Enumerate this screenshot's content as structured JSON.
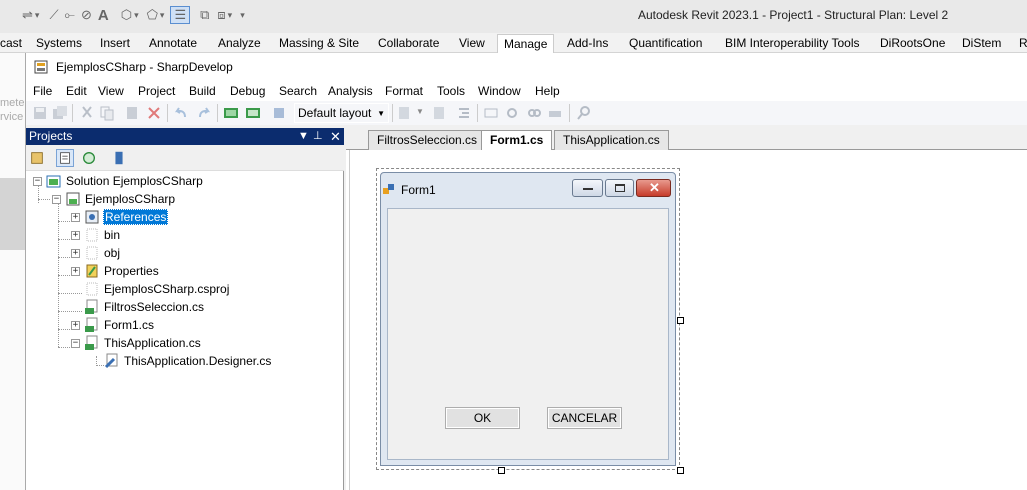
{
  "revit": {
    "title": "Autodesk Revit 2023.1 - Project1 - Structural Plan: Level 2",
    "tabs": [
      "cast",
      "Systems",
      "Insert",
      "Annotate",
      "Analyze",
      "Massing & Site",
      "Collaborate",
      "View",
      "Manage",
      "Add-Ins",
      "Quantification",
      "BIM Interoperability Tools",
      "DiRootsOne",
      "DiStem",
      "R"
    ],
    "active_tab": "Manage",
    "ghost_text": [
      "mete",
      "rvice"
    ]
  },
  "sd": {
    "title": "EjemplosCSharp - SharpDevelop",
    "menu": [
      "File",
      "Edit",
      "View",
      "Project",
      "Build",
      "Debug",
      "Search",
      "Analysis",
      "Format",
      "Tools",
      "Window",
      "Help"
    ],
    "layout_value": "Default layout"
  },
  "projects": {
    "header": "Projects",
    "tree": [
      {
        "label": "Solution EjemplosCSharp",
        "icon": "solution-icon"
      },
      {
        "label": "EjemplosCSharp",
        "icon": "project-icon"
      },
      {
        "label": "References",
        "icon": "references-icon",
        "selected": true
      },
      {
        "label": "bin",
        "icon": "folder-icon"
      },
      {
        "label": "obj",
        "icon": "folder-icon"
      },
      {
        "label": "Properties",
        "icon": "properties-icon"
      },
      {
        "label": "EjemplosCSharp.csproj",
        "icon": "file-icon"
      },
      {
        "label": "FiltrosSeleccion.cs",
        "icon": "cs-file-icon"
      },
      {
        "label": "Form1.cs",
        "icon": "cs-file-icon"
      },
      {
        "label": "ThisApplication.cs",
        "icon": "cs-file-icon"
      },
      {
        "label": "ThisApplication.Designer.cs",
        "icon": "designer-file-icon"
      }
    ]
  },
  "doc_tabs": [
    "FiltrosSeleccion.cs",
    "Form1.cs",
    "ThisApplication.cs"
  ],
  "active_doc_tab": "Form1.cs",
  "form": {
    "title": "Form1",
    "ok_label": "OK",
    "cancel_label": "CANCELAR"
  },
  "colors": {
    "pad_header": "#0b2c6e",
    "selection": "#0078d7",
    "close_button": "#c63b2a"
  }
}
